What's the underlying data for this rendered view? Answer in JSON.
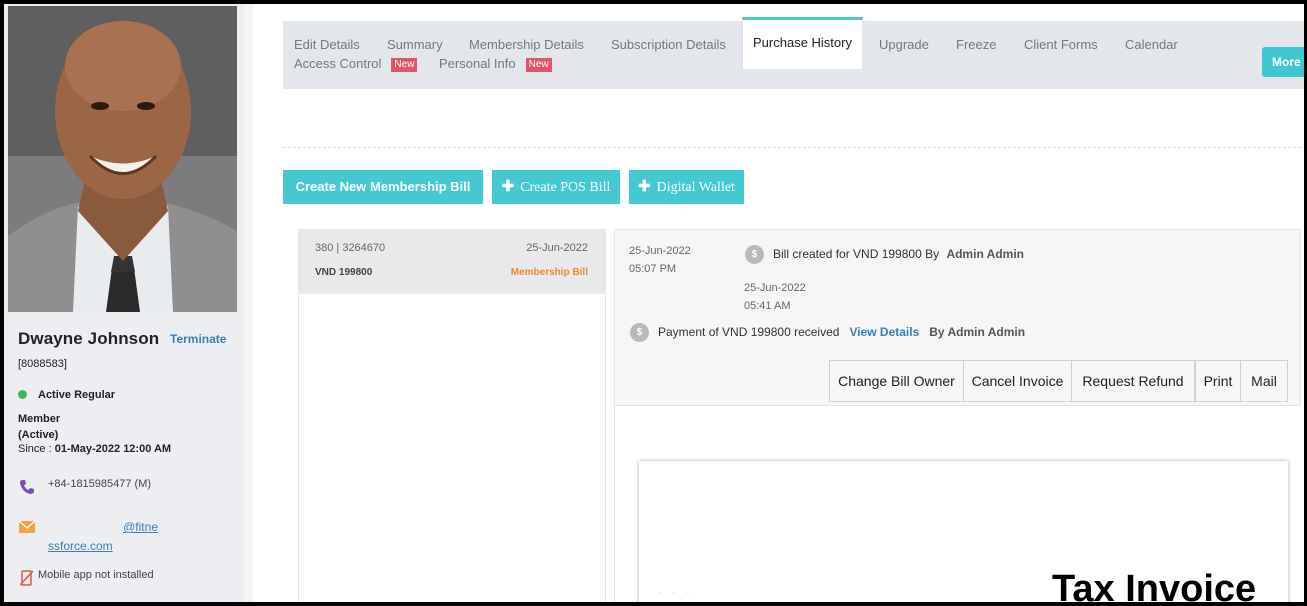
{
  "profile": {
    "name": "Dwayne Johnson",
    "terminate_label": "Terminate",
    "member_id": "[8088583]",
    "status": "Active Regular",
    "member_type_line1": "Member",
    "member_type_line2": "(Active)",
    "since_label": "Since :",
    "since_value": "01-May-2022 12:00 AM",
    "phone": "+84-1815985477 (M)",
    "email_line1": "@fitne",
    "email_line2": "ssforce.com",
    "app_status": "Mobile app not installed"
  },
  "tabs": [
    {
      "label": "Edit Details"
    },
    {
      "label": "Summary"
    },
    {
      "label": "Membership Details"
    },
    {
      "label": "Subscription Details"
    },
    {
      "label": "Purchase History"
    },
    {
      "label": "Upgrade"
    },
    {
      "label": "Freeze"
    },
    {
      "label": "Client Forms"
    },
    {
      "label": "Calendar"
    },
    {
      "label": "Access Control",
      "badge": "New"
    },
    {
      "label": "Personal Info",
      "badge": "New"
    }
  ],
  "more_label": "More",
  "actions": {
    "create_membership_bill": "Create New Membership Bill",
    "create_pos_bill": "Create POS Bill",
    "digital_wallet": "Digital Wallet"
  },
  "bill": {
    "number": "380 | 3264670",
    "date": "25-Jun-2022",
    "amount": "VND 199800",
    "type": "Membership Bill"
  },
  "detail": {
    "created_date": "25-Jun-2022",
    "created_time": "05:07 PM",
    "created_text": "Bill created for VND 199800 By",
    "created_by": "Admin Admin",
    "payment_date": "25-Jun-2022",
    "payment_time": "05:41 AM",
    "payment_text": "Payment of VND 199800 received",
    "view_details": "View Details",
    "payment_by": "By Admin Admin",
    "coin_symbol": "$"
  },
  "bill_actions": [
    "Change Bill Owner",
    "Cancel Invoice",
    "Request Refund",
    "Print",
    "Mail"
  ],
  "invoice": {
    "title": "Tax Invoice"
  },
  "colors": {
    "accent": "#44c8d2",
    "new_badge": "#e05769",
    "membership_bill": "#f08a24",
    "link": "#3a7dbb",
    "status_active": "#3fb65a"
  }
}
